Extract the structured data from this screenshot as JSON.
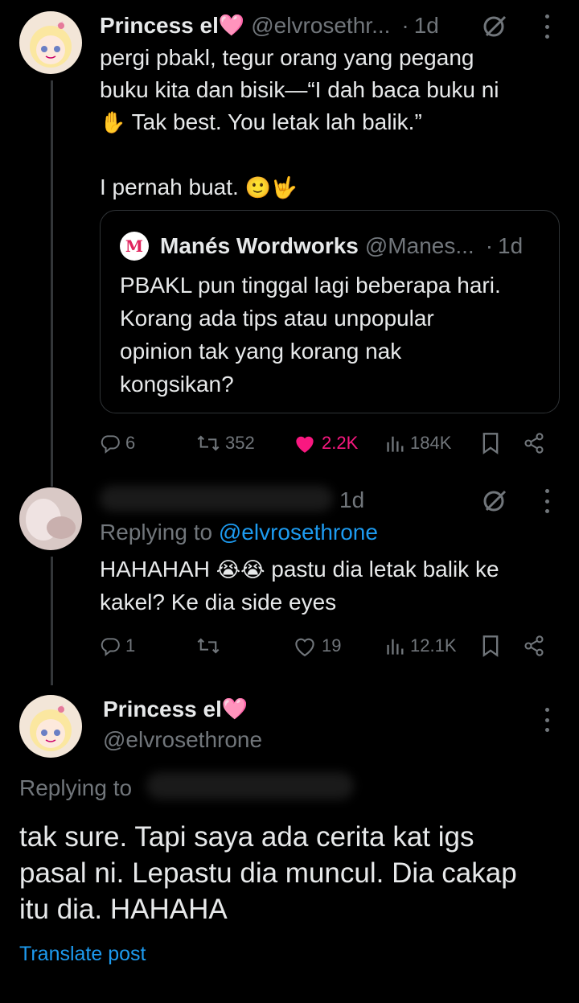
{
  "tweets": [
    {
      "display_name": "Princess el",
      "name_emoji": "🩷",
      "handle": "@elvrosethr...",
      "separator": "·",
      "time": "1d",
      "text_lines": [
        "pergi pbakl, tegur orang yang pegang",
        "buku kita dan bisik—“I dah baca buku ni",
        "Tak best. You letak lah balik.”",
        "",
        "I pernah buat."
      ],
      "hand_emoji": "✋",
      "end_emojis": "🙂🤟",
      "quote": {
        "avatar_letter": "M",
        "display_name": "Manés Wordworks",
        "handle": "@Manes...",
        "separator": "·",
        "time": "1d",
        "text_lines": [
          "PBAKL pun tinggal lagi beberapa hari.",
          "Korang ada tips atau unpopular",
          "opinion tak yang korang nak",
          "kongsikan?"
        ]
      },
      "stats": {
        "replies": "6",
        "reposts": "352",
        "likes": "2.2K",
        "views": "184K"
      }
    },
    {
      "time": "1d",
      "replying_label": "Replying to",
      "replying_handle": "@elvrosethrone",
      "text_line1_a": "HAHAHAH",
      "text_line1_emojis": "😭😭",
      "text_line1_b": "pastu dia letak balik ke",
      "text_line2": "kakel? Ke dia side eyes",
      "stats": {
        "replies": "1",
        "reposts": "",
        "likes": "19",
        "views": "12.1K"
      }
    },
    {
      "display_name": "Princess el",
      "name_emoji": "🩷",
      "handle": "@elvrosethrone",
      "replying_label": "Replying to",
      "text_lines": [
        "tak sure. Tapi saya ada cerita kat igs",
        "pasal ni. Lepastu dia muncul. Dia cakap",
        "itu dia. HAHAHA"
      ],
      "translate_label": "Translate post"
    }
  ],
  "colors": {
    "background": "#000000",
    "text": "#e7e9ea",
    "muted": "#71767b",
    "link": "#1d9bf0",
    "like": "#f91880"
  }
}
